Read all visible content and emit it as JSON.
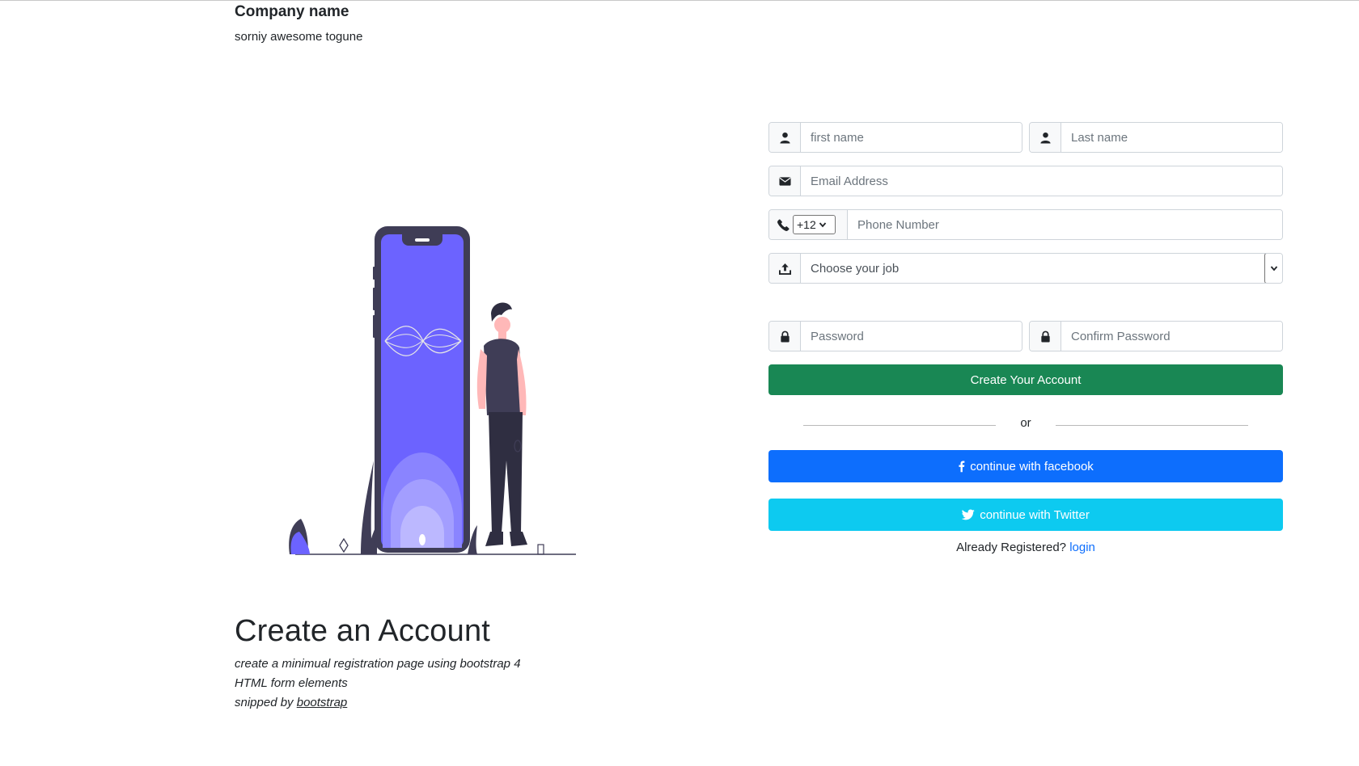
{
  "brand": {
    "name": "Company name",
    "tagline": "sorniy awesome togune"
  },
  "intro": {
    "title": "Create an Account",
    "line1": "create a minimual registration page using bootstrap 4",
    "line2": "HTML form elements",
    "line3_prefix": "snipped by ",
    "line3_link": "bootstrap"
  },
  "form": {
    "first_name_placeholder": "first name",
    "last_name_placeholder": "Last name",
    "email_placeholder": "Email Address",
    "phone_code": "+12",
    "phone_placeholder": "Phone Number",
    "job_select": "Choose your job",
    "password_placeholder": "Password",
    "confirm_password_placeholder": "Confirm Password",
    "create_button": "Create Your Account",
    "or_text": "or",
    "facebook_button": "continue with facebook",
    "twitter_button": "continue with Twitter",
    "already_registered": "Already Registered?",
    "login_link": "login"
  },
  "colors": {
    "success": "#198754",
    "facebook": "#0d6efd",
    "twitter": "#0dcaf0",
    "illustration_accent": "#6c63ff"
  },
  "icons": [
    "user-icon",
    "envelope-icon",
    "phone-icon",
    "upload-icon",
    "lock-icon",
    "facebook-icon",
    "twitter-icon"
  ]
}
